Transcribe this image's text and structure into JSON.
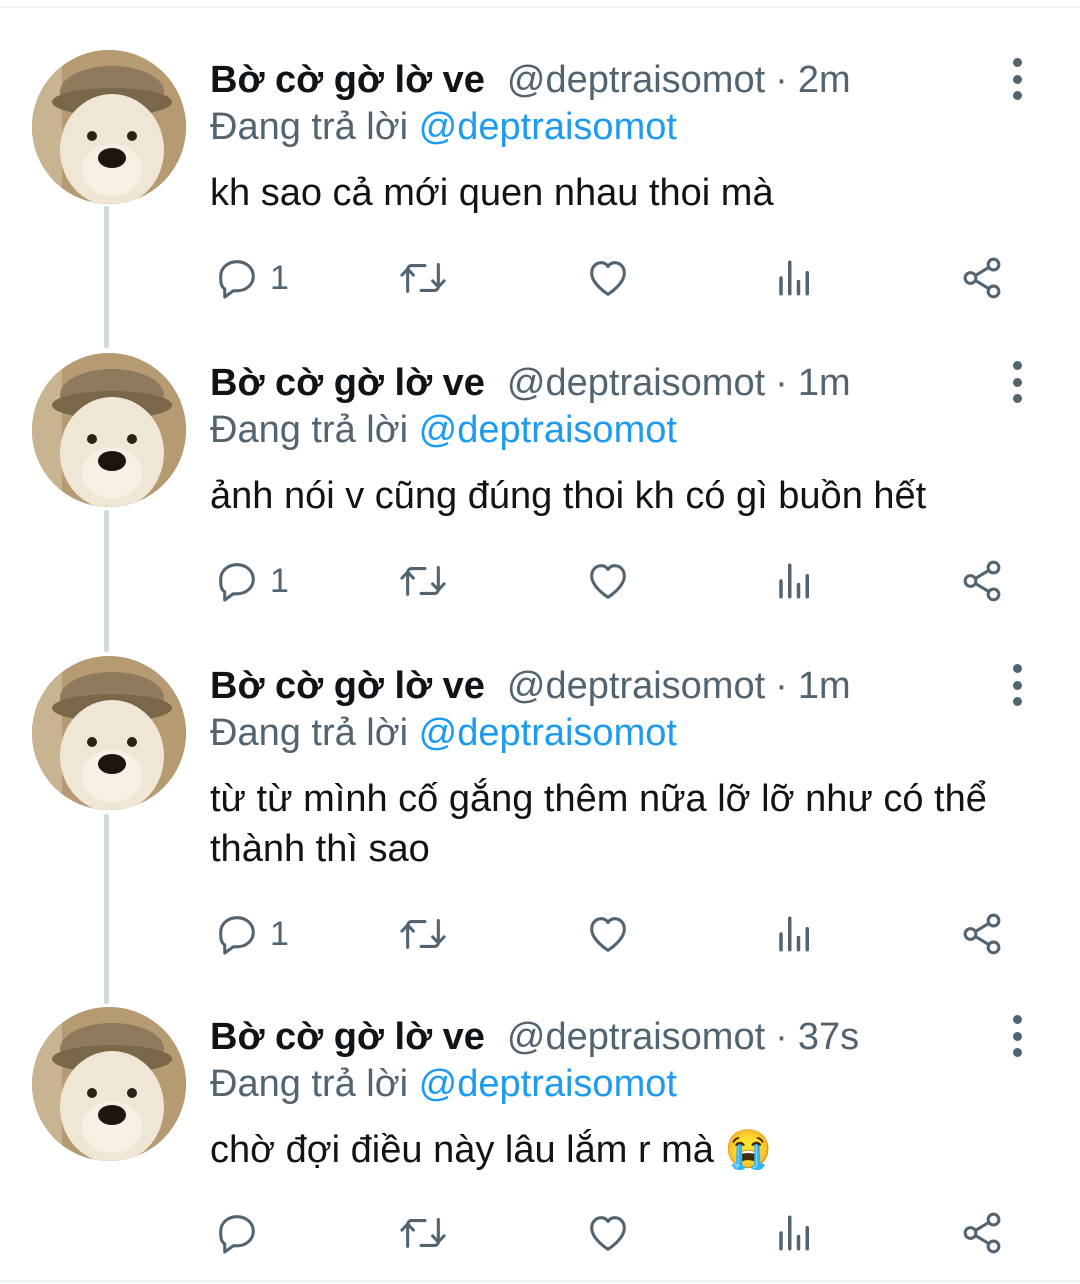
{
  "tweets": [
    {
      "name": "Bờ cờ gờ lờ ve",
      "handle": "@deptraisomot",
      "separator": "·",
      "time": "2m",
      "replying_prefix": "Đang trả lời",
      "replying_to": "@deptraisomot",
      "text": "kh sao cả mới quen nhau thoi mà",
      "reply_count": "1"
    },
    {
      "name": "Bờ cờ gờ lờ ve",
      "handle": "@deptraisomot",
      "separator": "·",
      "time": "1m",
      "replying_prefix": "Đang trả lời",
      "replying_to": "@deptraisomot",
      "text": "ảnh nói v cũng đúng thoi kh có gì buồn hết",
      "reply_count": "1"
    },
    {
      "name": "Bờ cờ gờ lờ ve",
      "handle": "@deptraisomot",
      "separator": "·",
      "time": "1m",
      "replying_prefix": "Đang trả lời",
      "replying_to": "@deptraisomot",
      "text": "từ từ mình cố gắng thêm nữa lỡ lỡ như có thể thành thì sao",
      "reply_count": "1"
    },
    {
      "name": "Bờ cờ gờ lờ ve",
      "handle": "@deptraisomot",
      "separator": "·",
      "time": "37s",
      "replying_prefix": "Đang trả lời",
      "replying_to": "@deptraisomot",
      "text": "chờ đợi điều này lâu lắm r mà 😭",
      "reply_count": ""
    }
  ],
  "colors": {
    "text": "#0f1419",
    "secondary": "#536471",
    "mention": "#1d9bf0",
    "thread_line": "#cfd9de"
  },
  "icons": [
    "reply-icon",
    "retweet-icon",
    "like-icon",
    "analytics-icon",
    "share-icon",
    "more-icon"
  ]
}
